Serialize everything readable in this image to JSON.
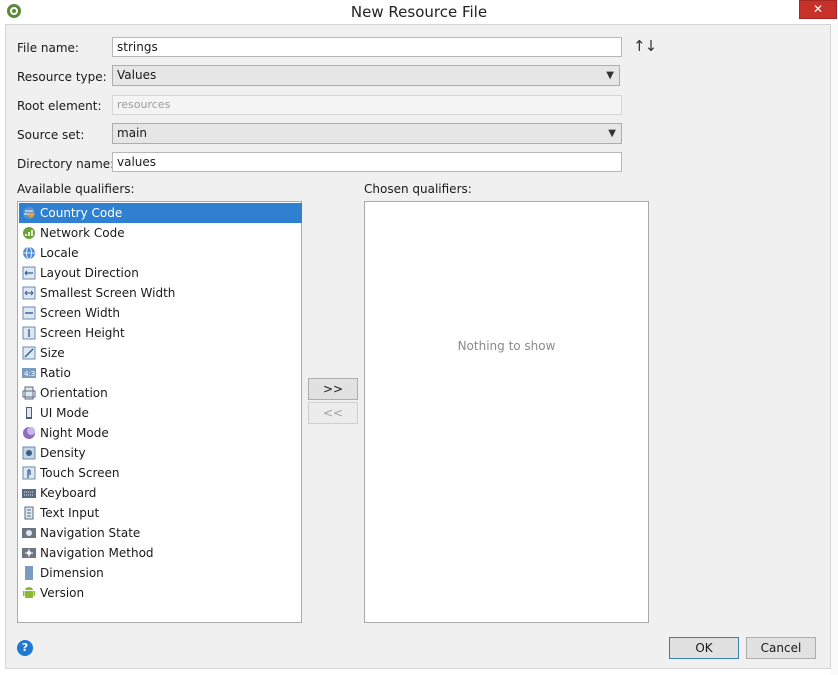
{
  "window": {
    "title": "New Resource File",
    "close_glyph": "✕"
  },
  "form": {
    "file_name": {
      "label": "File name:",
      "value": "strings"
    },
    "resource_type": {
      "label": "Resource type:",
      "value": "Values"
    },
    "root_element": {
      "label": "Root element:",
      "placeholder": "resources"
    },
    "source_set": {
      "label": "Source set:",
      "value": "main"
    },
    "directory_name": {
      "label": "Directory name:",
      "value": "values"
    }
  },
  "qualifiers": {
    "available_label": "Available qualifiers:",
    "chosen_label": "Chosen qualifiers:",
    "chosen_empty": "Nothing to show",
    "add_label": ">>",
    "remove_label": "<<",
    "available": [
      {
        "label": "Country Code",
        "icon": "globe-pin-icon",
        "selected": true
      },
      {
        "label": "Network Code",
        "icon": "signal-icon"
      },
      {
        "label": "Locale",
        "icon": "globe-icon"
      },
      {
        "label": "Layout Direction",
        "icon": "layout-direction-icon"
      },
      {
        "label": "Smallest Screen Width",
        "icon": "smallest-width-icon"
      },
      {
        "label": "Screen Width",
        "icon": "screen-width-icon"
      },
      {
        "label": "Screen Height",
        "icon": "screen-height-icon"
      },
      {
        "label": "Size",
        "icon": "size-icon"
      },
      {
        "label": "Ratio",
        "icon": "ratio-icon"
      },
      {
        "label": "Orientation",
        "icon": "orientation-icon"
      },
      {
        "label": "UI Mode",
        "icon": "ui-mode-icon"
      },
      {
        "label": "Night Mode",
        "icon": "moon-icon"
      },
      {
        "label": "Density",
        "icon": "density-icon"
      },
      {
        "label": "Touch Screen",
        "icon": "touch-icon"
      },
      {
        "label": "Keyboard",
        "icon": "keyboard-icon"
      },
      {
        "label": "Text Input",
        "icon": "text-input-icon"
      },
      {
        "label": "Navigation State",
        "icon": "navigation-state-icon"
      },
      {
        "label": "Navigation Method",
        "icon": "navigation-method-icon"
      },
      {
        "label": "Dimension",
        "icon": "dimension-icon"
      },
      {
        "label": "Version",
        "icon": "android-icon"
      }
    ]
  },
  "buttons": {
    "ok": "OK",
    "cancel": "Cancel",
    "help": "?"
  }
}
